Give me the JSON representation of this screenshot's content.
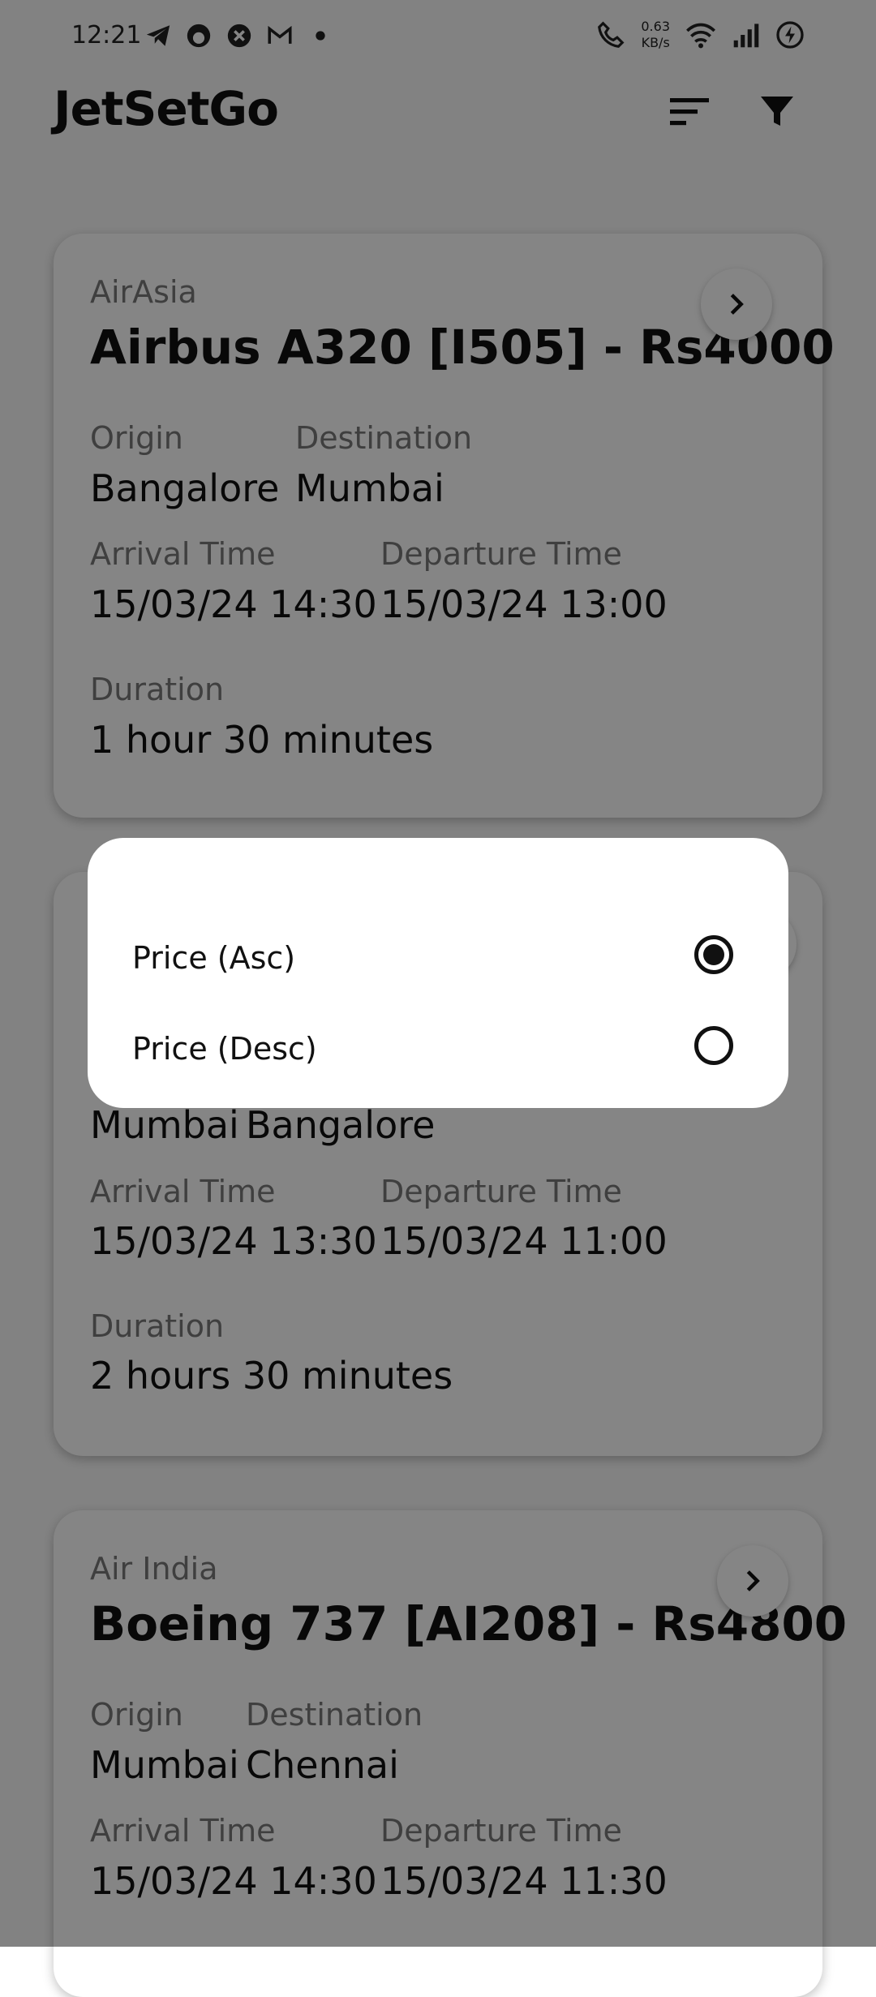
{
  "status": {
    "time": "12:21",
    "speed_value": "0.63",
    "speed_unit": "KB/s"
  },
  "app": {
    "title": "JetSetGo",
    "sort_icon": "sort-icon",
    "filter_icon": "filter-icon"
  },
  "flights": [
    {
      "airline": "AirAsia",
      "title": "Airbus A320 [I505] - Rs4000",
      "origin_label": "Origin",
      "origin": "Bangalore",
      "destination_label": "Destination",
      "destination": "Mumbai",
      "arrival_label": "Arrival Time",
      "arrival": "15/03/24 14:30",
      "departure_label": "Departure Time",
      "departure": "15/03/24 13:00",
      "duration_label": "Duration",
      "duration": "1 hour 30 minutes"
    },
    {
      "origin": "Mumbai",
      "destination": "Bangalore",
      "arrival_label": "Arrival Time",
      "arrival": "15/03/24 13:30",
      "departure_label": "Departure Time",
      "departure": "15/03/24 11:00",
      "duration_label": "Duration",
      "duration": "2 hours 30 minutes"
    },
    {
      "airline": "Air India",
      "title": "Boeing 737 [AI208] - Rs4800",
      "origin_label": "Origin",
      "origin": "Mumbai",
      "destination_label": "Destination",
      "destination": "Chennai",
      "arrival_label": "Arrival Time",
      "arrival": "15/03/24 14:30",
      "departure_label": "Departure Time",
      "departure": "15/03/24 11:30"
    }
  ],
  "sort_dialog": {
    "options": [
      {
        "label": "Price (Asc)",
        "selected": true
      },
      {
        "label": "Price (Desc)",
        "selected": false
      }
    ]
  }
}
